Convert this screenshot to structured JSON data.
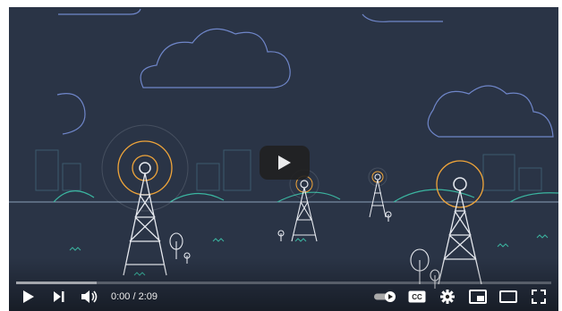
{
  "player": {
    "time_display": "0:00 / 2:09",
    "progress_fraction": 0,
    "buffered_fraction": 0.15,
    "captions_label": "CC",
    "colors": {
      "background": "#2a3446",
      "accent": "#ff0000",
      "illustration_line": "#e6e9ef",
      "glow_orange": "#f0a53a"
    }
  }
}
